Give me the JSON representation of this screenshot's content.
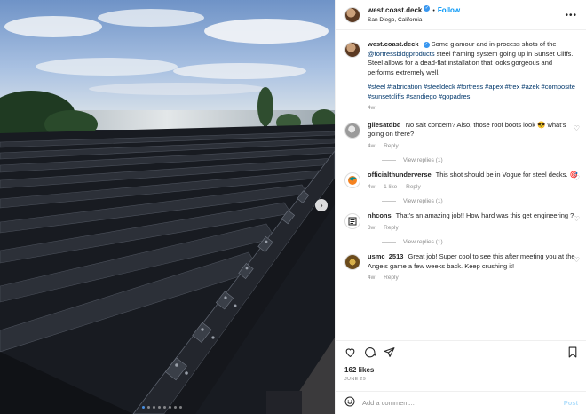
{
  "header": {
    "username": "west.coast.deck",
    "follow_label": "Follow",
    "location": "San Diego, California",
    "more_label": "•••"
  },
  "caption": {
    "username": "west.coast.deck",
    "text_before": "Some glamour and in-process shots of the",
    "mention": "@fortressbldgproducts",
    "text_after": "steel framing system going up in Sunset Cliffs. Steel allows for a dead-flat installation that looks gorgeous and performs extremely well.",
    "hashtags": "#steel #fabrication #steeldeck #fortress #apex #trex #azek #composite #sunsetcliffs #sandiego #gopadres",
    "time": "4w"
  },
  "comments": [
    {
      "username": "gilesatdbd",
      "text": "No salt concern? Also, those roof boots look 😎 what's going on there?",
      "time": "4w",
      "likes": "",
      "reply_label": "Reply",
      "view_replies": "View replies (1)"
    },
    {
      "username": "officialthunderverse",
      "text": "This shot should be in Vogue for steel decks. 🎯",
      "time": "4w",
      "likes": "1 like",
      "reply_label": "Reply",
      "view_replies": "View replies (1)"
    },
    {
      "username": "nhcons",
      "text": "That's an amazing job!! How hard was this get engineering ?",
      "time": "3w",
      "likes": "",
      "reply_label": "Reply",
      "view_replies": "View replies (1)"
    },
    {
      "username": "usmc_2513",
      "text": "Great job! Super cool to see this after meeting you at the Angels game a few weeks back. Keep crushing it!",
      "time": "4w",
      "likes": "",
      "reply_label": "Reply",
      "view_replies": ""
    }
  ],
  "post": {
    "likes": "162 likes",
    "date": "JUNE 29"
  },
  "add_comment": {
    "placeholder": "Add a comment...",
    "post_label": "Post"
  },
  "carousel": {
    "total": 8,
    "active": 1
  },
  "colors": {
    "link": "#00376b",
    "follow": "#0095f6",
    "verified": "#3897f0"
  }
}
